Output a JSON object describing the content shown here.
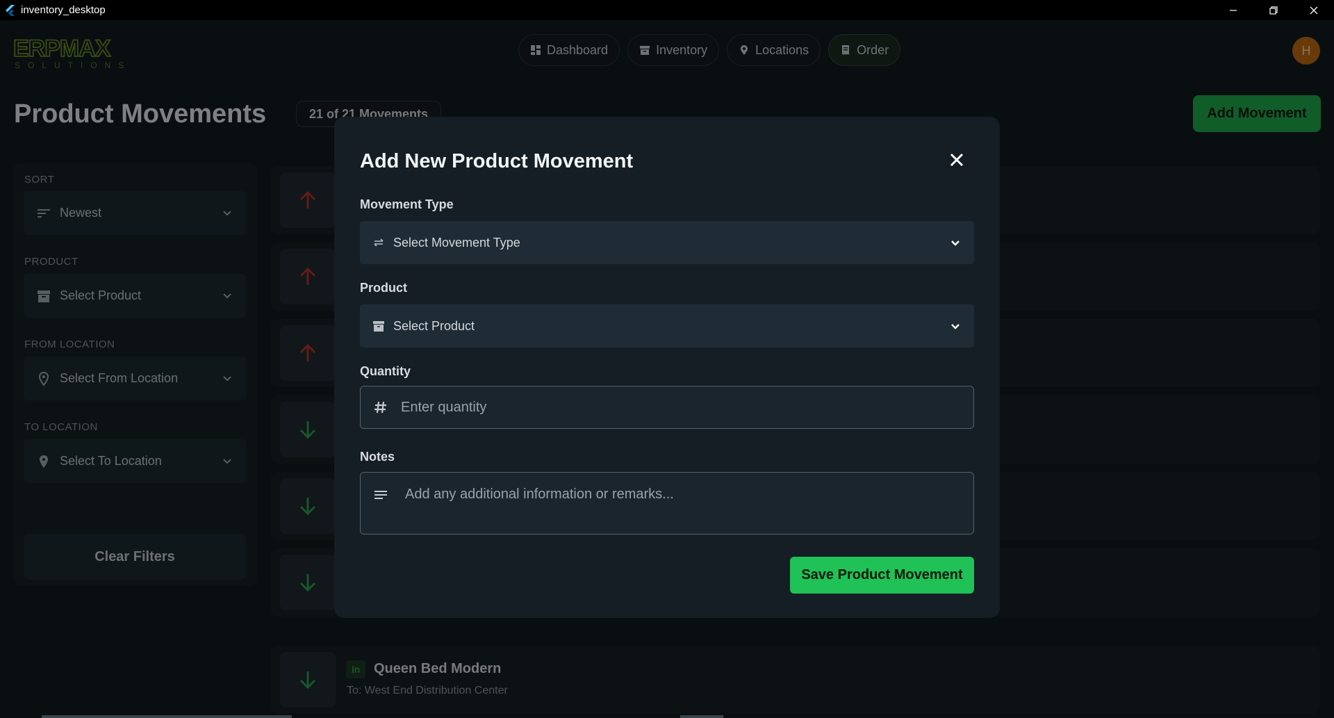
{
  "window": {
    "title": "inventory_desktop"
  },
  "logo": {
    "line1": "ERPMAX",
    "line2": "SOLUTIONS"
  },
  "nav": {
    "items": [
      {
        "label": "Dashboard",
        "icon": "dashboard-icon"
      },
      {
        "label": "Inventory",
        "icon": "archive-icon"
      },
      {
        "label": "Locations",
        "icon": "map-pin-icon"
      },
      {
        "label": "Order",
        "icon": "receipt-icon"
      }
    ],
    "active": "Order"
  },
  "user": {
    "avatar_initial": "H"
  },
  "page": {
    "title": "Product Movements",
    "count": "21 of 21 Movements",
    "add_button": "Add Movement"
  },
  "filters": {
    "sort_label": "SORT",
    "sort_value": "Newest",
    "product_label": "PRODUCT",
    "product_placeholder": "Select Product",
    "from_label": "FROM LOCATION",
    "from_placeholder": "Select From Location",
    "to_label": "TO LOCATION",
    "to_placeholder": "Select To Location",
    "clear_button": "Clear Filters"
  },
  "movements": {
    "directions": [
      "out",
      "out",
      "out",
      "in",
      "in",
      "in",
      "in"
    ],
    "last": {
      "tag": "In",
      "name": "Queen Bed Modern",
      "sub": "To: West End Distribution Center"
    }
  },
  "modal": {
    "title": "Add New Product Movement",
    "movement_type_label": "Movement Type",
    "movement_type_placeholder": "Select Movement Type",
    "product_label": "Product",
    "product_placeholder": "Select Product",
    "quantity_label": "Quantity",
    "quantity_placeholder": "Enter quantity",
    "notes_label": "Notes",
    "notes_placeholder": "Add any additional information or remarks...",
    "save_button": "Save Product Movement"
  },
  "colors": {
    "accent_green": "#20c156",
    "out_arrow": "#c0392b",
    "in_arrow": "#2e9e4f"
  }
}
